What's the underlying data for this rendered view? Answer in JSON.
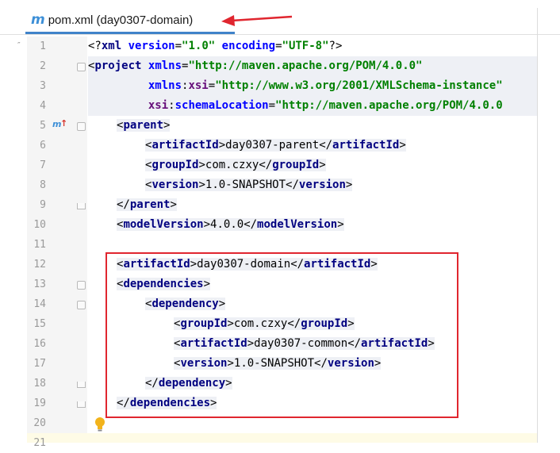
{
  "tab": {
    "icon": "maven-m-icon",
    "title": "pom.xml (day0307-domain)"
  },
  "gutter": {
    "line_numbers": [
      "1",
      "2",
      "3",
      "4",
      "5",
      "6",
      "7",
      "8",
      "9",
      "10",
      "11",
      "12",
      "13",
      "14",
      "15",
      "16",
      "17",
      "18",
      "19",
      "20",
      "21"
    ]
  },
  "colors": {
    "tag": "#000080",
    "attribute": "#0000ff",
    "namespace": "#660e7a",
    "string": "#008000",
    "annotation_red": "#e0262f",
    "tab_underline": "#4083c9"
  },
  "code": {
    "l1": {
      "open": "<?",
      "kw": "xml",
      "a1": "version",
      "eq1": "=",
      "v1": "\"1.0\"",
      "a2": "encoding",
      "eq2": "=",
      "v2": "\"UTF-8\"",
      "close": "?>"
    },
    "l2": {
      "open": "<",
      "tag": "project",
      "a1": "xmlns",
      "eq": "=",
      "v1": "\"http://maven.apache.org/POM/4.0.0\""
    },
    "l3": {
      "ns": "xmlns",
      "colon": ":",
      "a1": "xsi",
      "eq": "=",
      "v1": "\"http://www.w3.org/2001/XMLSchema-instance\""
    },
    "l4": {
      "ns": "xsi",
      "colon": ":",
      "a1": "schemaLocation",
      "eq": "=",
      "v1": "\"http://maven.apache.org/POM/4.0.0"
    },
    "l5": {
      "tag": "parent"
    },
    "l6": {
      "tag": "artifactId",
      "value": "day0307-parent"
    },
    "l7": {
      "tag": "groupId",
      "value": "com.czxy"
    },
    "l8": {
      "tag": "version",
      "value": "1.0-SNAPSHOT"
    },
    "l9": {
      "tag": "parent"
    },
    "l10": {
      "tag": "modelVersion",
      "value": "4.0.0"
    },
    "l12": {
      "tag": "artifactId",
      "value": "day0307-domain"
    },
    "l13": {
      "tag": "dependencies"
    },
    "l14": {
      "tag": "dependency"
    },
    "l15": {
      "tag": "groupId",
      "value": "com.czxy"
    },
    "l16": {
      "tag": "artifactId",
      "value": "day0307-common"
    },
    "l17": {
      "tag": "version",
      "value": "1.0-SNAPSHOT"
    },
    "l18": {
      "tag": "dependency"
    },
    "l19": {
      "tag": "dependencies"
    }
  },
  "markers": {
    "line5_gutter": "maven-override-icon",
    "line20_gutter": "lightbulb-icon"
  }
}
